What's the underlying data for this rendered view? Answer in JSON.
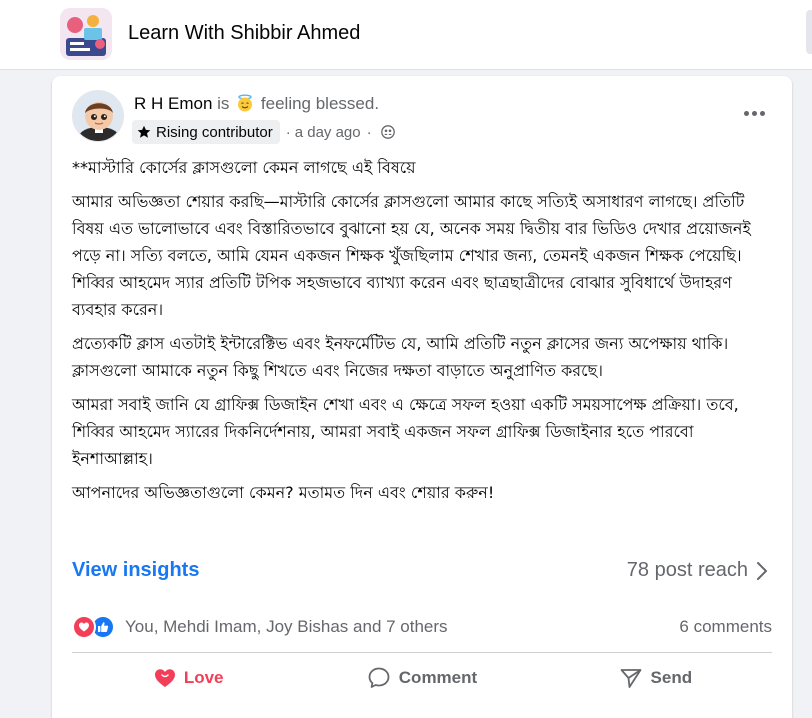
{
  "group": {
    "name": "Learn With Shibbir Ahmed"
  },
  "post": {
    "author": "R H Emon",
    "connector": "is",
    "feeling": "feeling blessed.",
    "badge": "Rising contributor",
    "time_prefix": "·",
    "time": "a day ago",
    "time_suffix": "·",
    "paragraphs": [
      "**মাস্টারি কোর্সের ক্লাসগুলো কেমন লাগছে এই বিষয়ে",
      "আমার অভিজ্ঞতা শেয়ার করছি—মাস্টারি কোর্সের ক্লাসগুলো আমার কাছে সত্যিই অসাধারণ লাগছে। প্রতিটি বিষয় এত ভালোভাবে এবং বিস্তারিতভাবে বুঝানো হয় যে, অনেক সময় দ্বিতীয় বার ভিডিও দেখার প্রয়োজনই পড়ে না। সত্যি বলতে, আমি যেমন একজন শিক্ষক খুঁজছিলাম শেখার জন্য, তেমনই একজন শিক্ষক পেয়েছি। শিব্বির আহমেদ স্যার প্রতিটি টপিক সহজভাবে ব্যাখ্যা করেন এবং ছাত্রছাত্রীদের বোঝার সুবিধার্থে উদাহরণ ব্যবহার করেন।",
      "প্রত্যেকটি ক্লাস এতটাই ইন্টারেক্টিভ এবং ইনফর্মেটিভ যে, আমি প্রতিটি নতুন ক্লাসের জন্য অপেক্ষায় থাকি। ক্লাসগুলো আমাকে নতুন কিছু শিখতে এবং নিজের দক্ষতা বাড়াতে অনুপ্রাণিত করছে।",
      "আমরা সবাই জানি যে গ্রাফিক্স ডিজাইন শেখা এবং এ ক্ষেত্রে সফল হওয়া একটি সময়সাপেক্ষ প্রক্রিয়া। তবে, শিব্বির আহমেদ স্যারের দিকনির্দেশনায়, আমরা সবাই একজন সফল গ্রাফিক্স ডিজাইনার হতে পারবো ইনশাআল্লাহ।",
      "আপনাদের অভিজ্ঞতাগুলো কেমন? মতামত দিন এবং শেয়ার করুন!"
    ],
    "view_insights": "View insights",
    "post_reach": "78 post reach",
    "reactors": "You, Mehdi Imam, Joy Bishas and 7 others",
    "comments": "6 comments"
  },
  "actions": {
    "love": "Love",
    "comment": "Comment",
    "send": "Send"
  },
  "icons": {
    "feeling": "smiling-face-with-halo-icon",
    "badge": "star-icon",
    "privacy": "group-members-icon",
    "more": "more-options-icon",
    "chevron": "chevron-right-icon",
    "reaction_love": "heart-reaction-icon",
    "reaction_like": "thumbs-up-reaction-icon",
    "love": "heart-icon",
    "comment": "comment-bubble-icon",
    "send": "send-arrow-icon"
  },
  "colors": {
    "accent": "#1877f2",
    "love": "#f33e58",
    "muted_text": "#65676b",
    "text": "#050505",
    "page_bg": "#f0f2f5"
  }
}
